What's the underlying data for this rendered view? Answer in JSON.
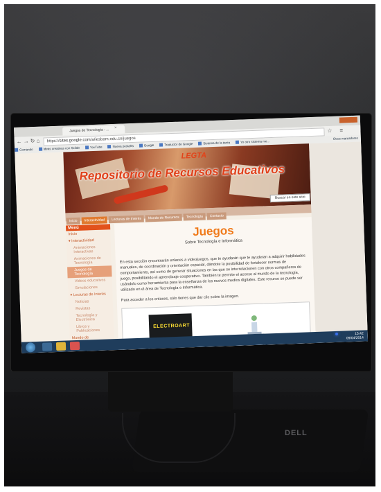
{
  "browser": {
    "tab_title": "Juegos de Tecnología - ...",
    "url_prefix": "https://",
    "url_domain": "sites.google.com",
    "url_path": "/a/iesbam.edu.co/juegos",
    "bookmarks": [
      "Comando",
      "Ideas creativas con Scilab",
      "YouTube",
      "Nueva pestaña",
      "Google",
      "Traductor de Google",
      "Sistema de la tarea",
      "Yo otro sistema me..."
    ],
    "other_bookmarks": "Otros marcadores"
  },
  "site": {
    "logo": "LEGTA",
    "banner_title": "Repositorio de Recursos Educativos",
    "search_button": "Buscar en este sitio",
    "nav": [
      "Inicio",
      "Interactividad",
      "Lecturas de Interés",
      "Mundo de Recursos",
      "Tecnología",
      "Contacto"
    ],
    "nav_active_index": 1,
    "menu_title": "Menú",
    "menu_items": [
      {
        "label": "Inicio",
        "level": 0
      },
      {
        "label": "▾ Interactividad",
        "level": 0
      },
      {
        "label": "Animaciones Interactivas",
        "level": 1
      },
      {
        "label": "Animaciones de Tecnología",
        "level": 1
      },
      {
        "label": "Juegos de Tecnología",
        "level": 1,
        "selected": true
      },
      {
        "label": "Videos educativos",
        "level": 1
      },
      {
        "label": "Simulaciones",
        "level": 1
      },
      {
        "label": "▾ Lecturas de Interés",
        "level": 0
      },
      {
        "label": "Noticias",
        "level": 1
      },
      {
        "label": "Revistas",
        "level": 1
      },
      {
        "label": "Tecnología y Electrónica",
        "level": 1
      },
      {
        "label": "Libros y Publicaciones",
        "level": 1
      },
      {
        "label": "Mundo de",
        "level": 0
      }
    ],
    "page_title": "Juegos",
    "page_subtitle": "Sobre Tecnología e Informática",
    "intro": "En esta sección encontrarán enlaces a videojuegos, que te ayudarán que te ayuderan a adquirir habilidades manuales, de coordinación y orientación espacial, dándote la posibilidad de fortalecer normas de comportamiento, así como de generar situaciones en las que se interrelacionen con otros compañeros de juego, posibilitando el aprendizaje cooperativo. También te permite el acceso al mundo de la tecnología, usándolo como herramienta para la enseñanza de los nuevos medios digitales. Este recurso se puede ser utilizado en el área de Tecnología e Informática.",
    "instruction": "Para acceder a los enlaces, sólo tienes que dar clic sobre la imagen.",
    "game_tile": "ELECTROART"
  },
  "taskbar": {
    "time": "15:42",
    "date": "09/04/2014"
  },
  "monitor": {
    "brand": "DELL"
  },
  "colors": {
    "accent": "#f07a1a",
    "banner": "#a14b2d",
    "taskbar": "#1f3d5c"
  }
}
